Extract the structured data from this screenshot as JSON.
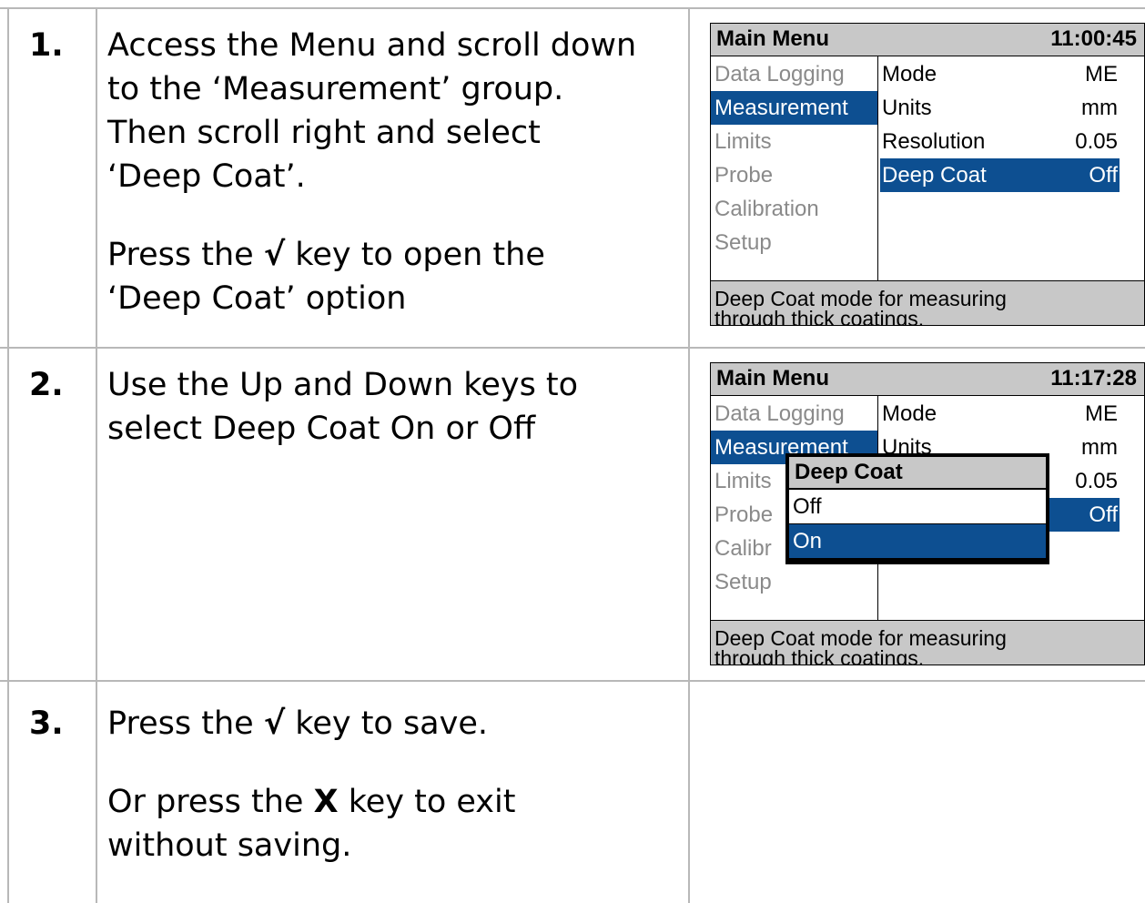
{
  "steps": [
    {
      "number": "1.",
      "lines": [
        "Access the Menu and scroll down",
        "to the ‘Measurement’ group.",
        "Then scroll right and select",
        "‘Deep Coat’."
      ],
      "para2_before": "Press the ",
      "para2_key": "√",
      "para2_after": " key to open the",
      "para2_line2": "‘Deep Coat’ option"
    },
    {
      "number": "2.",
      "lines": [
        "Use the Up and Down keys to",
        "select Deep Coat On or Off"
      ]
    },
    {
      "number": "3.",
      "para1_before": "Press the ",
      "para1_key": "√",
      "para1_after": " key to save.",
      "para2_before": "Or press the ",
      "para2_key": "X",
      "para2_after": " key to exit",
      "para2_line2": "without saving."
    }
  ],
  "screen1": {
    "title": "Main Menu",
    "time": "11:00:45",
    "left_items": [
      "Data Logging",
      "Measurement",
      "Limits",
      "Probe",
      "Calibration",
      "Setup"
    ],
    "selected_left": 1,
    "right_items": [
      {
        "label": "Mode",
        "value": "ME"
      },
      {
        "label": "Units",
        "value": "mm"
      },
      {
        "label": "Resolution",
        "value": "0.05"
      },
      {
        "label": "Deep Coat",
        "value": "Off"
      }
    ],
    "footer_line1": "Deep Coat mode for measuring",
    "footer_line2": "through thick coatings."
  },
  "screen2": {
    "title": "Main Menu",
    "time": "11:17:28",
    "left_items": [
      "Data Logging",
      "Measurement",
      "Limits",
      "Probe",
      "Calibr",
      "Setup"
    ],
    "right_items": [
      {
        "label": "Mode",
        "value": "ME"
      },
      {
        "label": "Units",
        "value": "mm"
      },
      {
        "label": "",
        "value": "0.05"
      },
      {
        "label": "",
        "value": "Off"
      }
    ],
    "popup_title": "Deep Coat",
    "popup_options": [
      "Off",
      "On"
    ],
    "popup_selected": 1,
    "footer_line1": "Deep Coat mode for measuring",
    "footer_line2": "through thick coatings."
  },
  "colors": {
    "selection": "#0d4f91",
    "panel_gray": "#c8c8c8",
    "grid": "#b8b8b8"
  }
}
